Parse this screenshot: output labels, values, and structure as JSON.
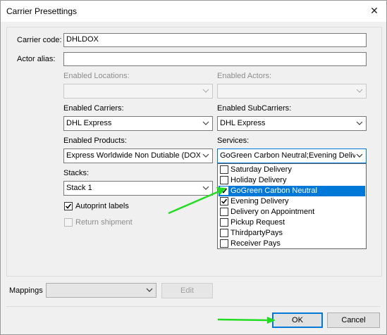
{
  "window": {
    "title": "Carrier Presettings",
    "close_glyph": "✕"
  },
  "form": {
    "carrier_code_label": "Carrier code:",
    "carrier_code_value": "DHLDOX",
    "actor_alias_label": "Actor alias:",
    "actor_alias_value": "",
    "enabled_locations_label": "Enabled Locations:",
    "enabled_locations_value": "",
    "enabled_actors_label": "Enabled Actors:",
    "enabled_actors_value": "",
    "enabled_carriers_label": "Enabled Carriers:",
    "enabled_carriers_value": "DHL Express",
    "enabled_subcarriers_label": "Enabled SubCarriers:",
    "enabled_subcarriers_value": "DHL Express",
    "enabled_products_label": "Enabled Products:",
    "enabled_products_value": "Express Worldwide Non Dutiable (DOX)",
    "services_label": "Services:",
    "services_value": "GoGreen Carbon Neutral;Evening Delive",
    "stacks_label": "Stacks:",
    "stacks_value": "Stack 1",
    "autoprint_label": "Autoprint labels",
    "autoprint_checked": true,
    "return_shipment_label": "Return shipment",
    "return_shipment_checked": false
  },
  "services_dropdown": {
    "items": [
      {
        "label": "Saturday Delivery",
        "checked": false,
        "selected": false
      },
      {
        "label": "Holiday Delivery",
        "checked": false,
        "selected": false
      },
      {
        "label": "GoGreen Carbon Neutral",
        "checked": true,
        "selected": true
      },
      {
        "label": "Evening Delivery",
        "checked": true,
        "selected": false
      },
      {
        "label": "Delivery on Appointment",
        "checked": false,
        "selected": false
      },
      {
        "label": "Pickup Request",
        "checked": false,
        "selected": false
      },
      {
        "label": "ThirdpartyPays",
        "checked": false,
        "selected": false
      },
      {
        "label": "Receiver Pays",
        "checked": false,
        "selected": false
      }
    ]
  },
  "mappings": {
    "label": "Mappings",
    "value": "",
    "edit_label": "Edit"
  },
  "footer": {
    "ok_label": "OK",
    "cancel_label": "Cancel"
  },
  "colors": {
    "accent": "#0078d7",
    "annotation": "#22dd22"
  }
}
